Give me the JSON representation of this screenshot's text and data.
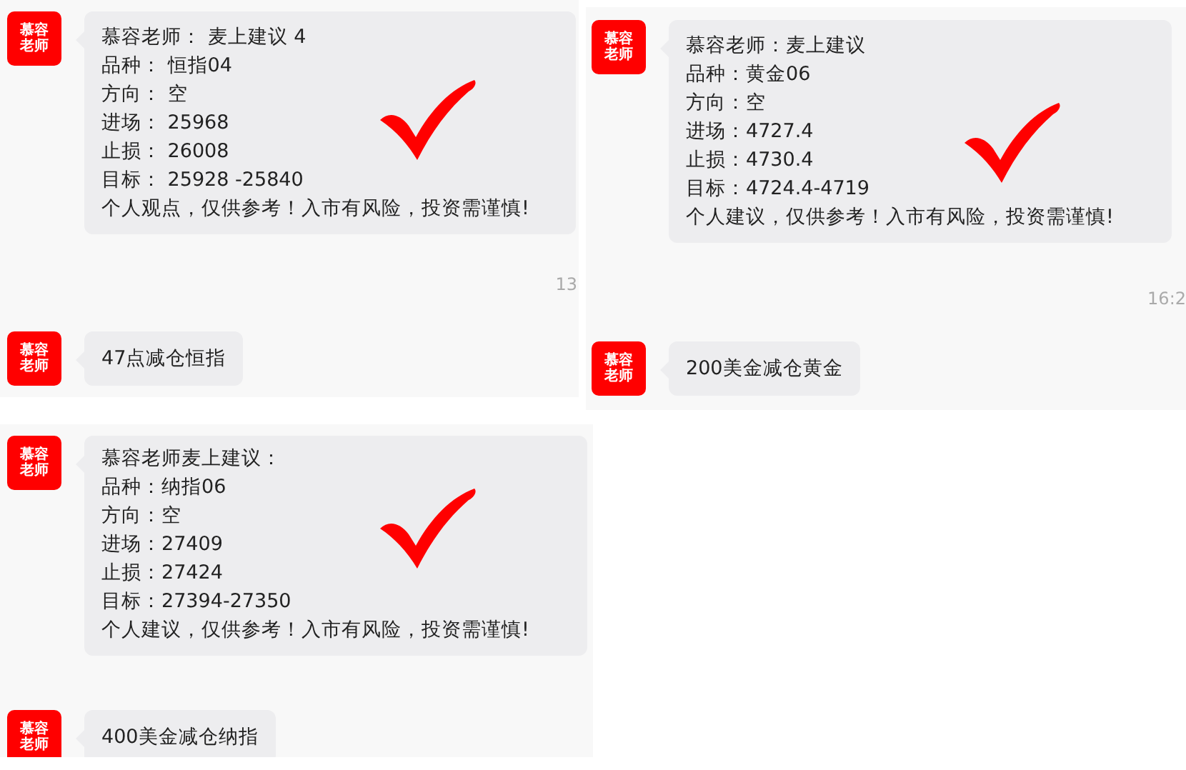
{
  "panels": [
    {
      "messages": [
        {
          "avatar": "慕容老师",
          "lines": [
            "慕容老师：  麦上建议 4",
            "品种：  恒指04",
            "方向：  空",
            "进场：  25968",
            "止损：  26008",
            "目标：  25928 -25840",
            "个人观点，仅供参考！入市有风险，投资需谨慎!"
          ],
          "checked": true
        },
        {
          "avatar": "慕容老师",
          "lines": [
            "47点减仓恒指"
          ],
          "checked": false
        }
      ],
      "timestamp": "13"
    },
    {
      "messages": [
        {
          "avatar": "慕容老师",
          "lines": [
            "慕容老师：麦上建议",
            "品种：黄金06",
            "方向：空",
            "进场：4727.4",
            "止损：4730.4",
            "目标：4724.4-4719",
            "个人建议，仅供参考！入市有风险，投资需谨慎!"
          ],
          "checked": true
        },
        {
          "avatar": "慕容老师",
          "lines": [
            "200美金减仓黄金"
          ],
          "checked": false
        }
      ],
      "timestamp": "16:2"
    },
    {
      "messages": [
        {
          "avatar": "慕容老师",
          "lines": [
            "慕容老师麦上建议：",
            "品种：纳指06",
            "方向：空",
            "进场：27409",
            "止损：27424",
            "目标：27394-27350",
            "个人建议，仅供参考！入市有风险，投资需谨慎!"
          ],
          "checked": true
        },
        {
          "avatar": "慕容老师",
          "lines": [
            "400美金减仓纳指"
          ],
          "checked": false
        }
      ]
    }
  ]
}
